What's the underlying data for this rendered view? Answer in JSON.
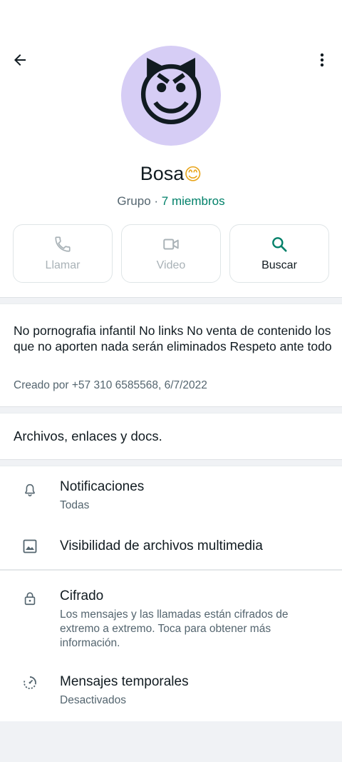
{
  "header": {
    "back_icon": "arrow-left-icon",
    "menu_icon": "more-vert-icon"
  },
  "group": {
    "avatar_emoji": "😈",
    "name": "Bosa",
    "name_emoji": "😊",
    "type_label": "Grupo",
    "separator": " · ",
    "members_label": "7 miembros"
  },
  "actions": [
    {
      "label": "Llamar",
      "icon": "phone-icon",
      "enabled": false
    },
    {
      "label": "Video",
      "icon": "videocam-icon",
      "enabled": false
    },
    {
      "label": "Buscar",
      "icon": "search-icon",
      "enabled": true
    }
  ],
  "description": {
    "text": "No pornografia infantil No links No venta de contenido  los que no aporten nada serán eliminados Respeto ante todo",
    "created_by": "Creado por +57 310 6585568, 6/7/2022"
  },
  "media": {
    "label": "Archivos, enlaces y docs."
  },
  "settings": {
    "notifications": {
      "title": "Notificaciones",
      "value": "Todas",
      "icon": "bell-icon"
    },
    "media_visibility": {
      "title": "Visibilidad de archivos multimedia",
      "icon": "image-icon"
    },
    "encryption": {
      "title": "Cifrado",
      "description": "Los mensajes y las llamadas están cifrados de extremo a extremo. Toca para obtener más información.",
      "icon": "lock-icon"
    },
    "disappearing": {
      "title": "Mensajes temporales",
      "value": "Desactivados",
      "icon": "timer-icon"
    }
  },
  "colors": {
    "accent": "#008069",
    "muted": "#54656f",
    "disabled": "#a9b2b7",
    "avatar_bg": "#d6cdf5",
    "band": "#f0f2f5"
  }
}
